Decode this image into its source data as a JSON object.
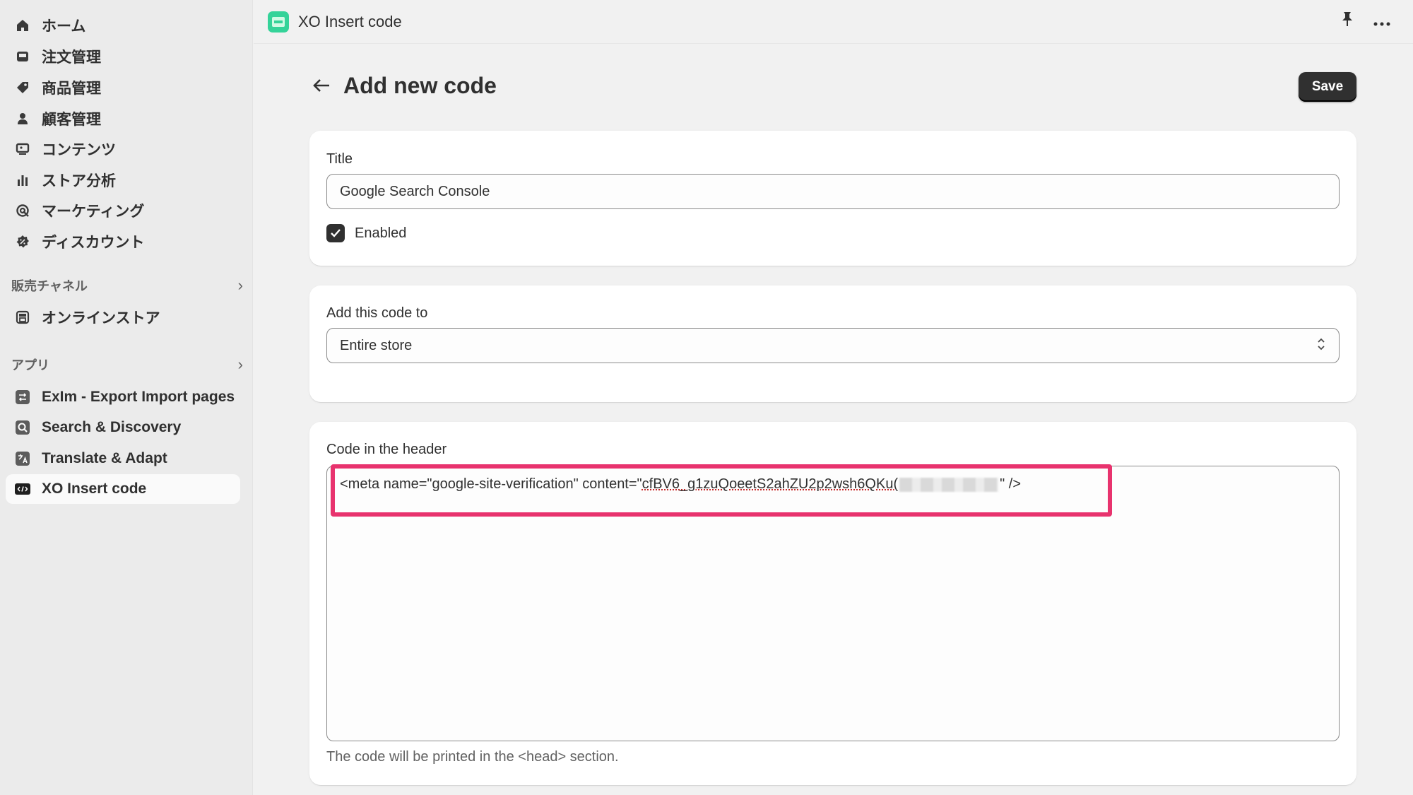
{
  "sidebar": {
    "items": [
      {
        "label": "ホーム",
        "icon": "home-icon"
      },
      {
        "label": "注文管理",
        "icon": "inbox-icon"
      },
      {
        "label": "商品管理",
        "icon": "tag-icon"
      },
      {
        "label": "顧客管理",
        "icon": "person-icon"
      },
      {
        "label": "コンテンツ",
        "icon": "content-icon"
      },
      {
        "label": "ストア分析",
        "icon": "bar-chart-icon"
      },
      {
        "label": "マーケティング",
        "icon": "target-icon"
      },
      {
        "label": "ディスカウント",
        "icon": "discount-icon"
      }
    ],
    "sales_channels": {
      "label": "販売チャネル",
      "items": [
        {
          "label": "オンラインストア",
          "icon": "store-icon"
        }
      ]
    },
    "apps": {
      "label": "アプリ",
      "items": [
        {
          "label": "ExIm - Export Import pages",
          "icon": "exim-icon"
        },
        {
          "label": "Search & Discovery",
          "icon": "search-discovery-icon"
        },
        {
          "label": "Translate & Adapt",
          "icon": "translate-icon"
        },
        {
          "label": "XO Insert code",
          "icon": "code-icon"
        }
      ]
    }
  },
  "topbar": {
    "app_title": "XO Insert code"
  },
  "page": {
    "title": "Add new code",
    "save_label": "Save"
  },
  "title_card": {
    "label": "Title",
    "value": "Google Search Console",
    "enabled_label": "Enabled",
    "enabled": true
  },
  "location_card": {
    "label": "Add this code to",
    "value": "Entire store"
  },
  "code_card": {
    "label": "Code in the header",
    "code_prefix": "<meta name=\"google-site-verification\" content=\"",
    "code_token": "cfBV6_g1zuQoeetS2ahZU2p2wsh6QKu(",
    "code_suffix": "\" />",
    "help": "The code will be printed in the <head> section."
  },
  "colors": {
    "accent_highlight": "#e8336e",
    "app_icon": "#34d399",
    "primary_button": "#303030"
  }
}
